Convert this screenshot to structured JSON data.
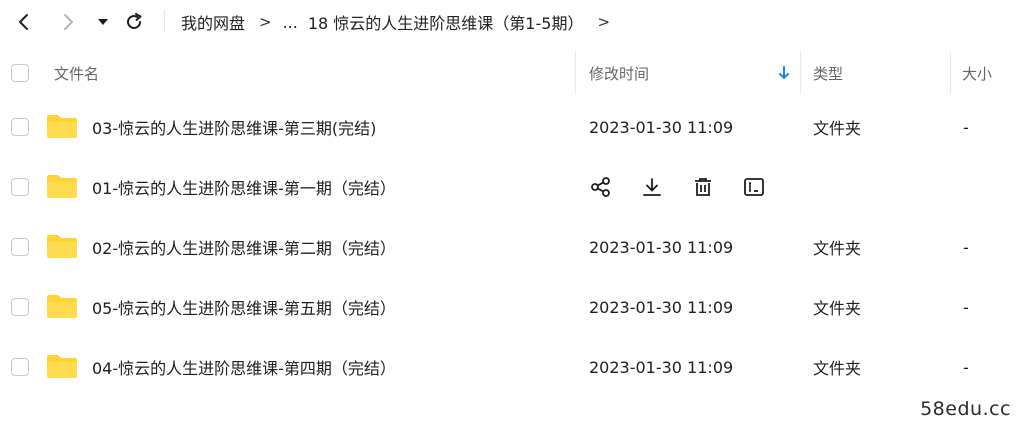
{
  "breadcrumb": {
    "root": "我的网盘",
    "separator": ">",
    "ellipsis": "...",
    "current": "18 惊云的人生进阶思维课（第1-5期）"
  },
  "table": {
    "columns": {
      "name": "文件名",
      "modified": "修改时间",
      "type": "类型",
      "size": "大小"
    },
    "sort_indicator": "arrow-down-icon",
    "rows": [
      {
        "name": "03-惊云的人生进阶思维课-第三期(完结)",
        "modified": "2023-01-30 11:09",
        "type": "文件夹",
        "size": "-"
      },
      {
        "name": "01-惊云的人生进阶思维课-第一期（完结）",
        "modified": "",
        "type": "",
        "size": "",
        "hover": true
      },
      {
        "name": "02-惊云的人生进阶思维课-第二期（完结）",
        "modified": "2023-01-30 11:09",
        "type": "文件夹",
        "size": "-"
      },
      {
        "name": "05-惊云的人生进阶思维课-第五期（完结）",
        "modified": "2023-01-30 11:09",
        "type": "文件夹",
        "size": "-"
      },
      {
        "name": "04-惊云的人生进阶思维课-第四期（完结）",
        "modified": "2023-01-30 11:09",
        "type": "文件夹",
        "size": "-"
      }
    ]
  },
  "row_actions": [
    "share-icon",
    "download-icon",
    "delete-icon",
    "rename-icon"
  ],
  "watermark": "58edu.cc",
  "colors": {
    "folder": "#ffd335",
    "sort_arrow": "#1e88e5"
  }
}
